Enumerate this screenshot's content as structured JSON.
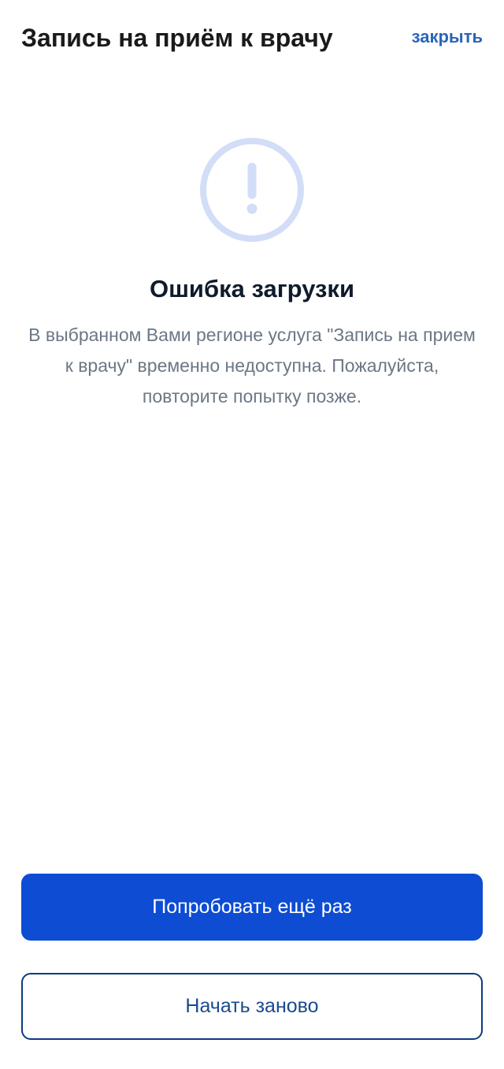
{
  "header": {
    "title": "Запись на приём к врачу",
    "close_label": "закрыть"
  },
  "error": {
    "icon": "exclamation-circle-icon",
    "title": "Ошибка загрузки",
    "message": "В выбранном Вами регионе услуга \"Запись на прием к врачу\" временно недоступна. Пожалуйста, повторите попытку позже."
  },
  "actions": {
    "retry_label": "Попробовать ещё раз",
    "restart_label": "Начать заново"
  },
  "colors": {
    "primary_button": "#0d4cd3",
    "link": "#2b64b8",
    "icon": "#d2ddf7"
  }
}
